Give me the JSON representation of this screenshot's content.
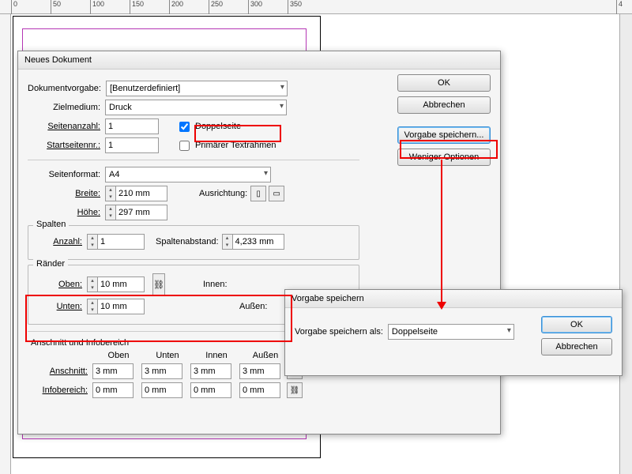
{
  "ruler_marks": [
    "0",
    "50",
    "100",
    "150",
    "200",
    "250",
    "300",
    "350",
    "4"
  ],
  "dialog": {
    "title": "Neues Dokument",
    "labels": {
      "dokvorgabe": "Dokumentvorgabe:",
      "zielmedium": "Zielmedium:",
      "seitenanzahl": "Seitenanzahl:",
      "startseite": "Startseitennr.:",
      "seitenformat": "Seitenformat:",
      "breite": "Breite:",
      "hoehe": "Höhe:",
      "ausrichtung": "Ausrichtung:",
      "spalten": "Spalten",
      "anzahl": "Anzahl:",
      "spaltenabstand": "Spaltenabstand:",
      "raender": "Ränder",
      "oben": "Oben:",
      "unten": "Unten:",
      "innen": "Innen:",
      "aussen": "Außen:",
      "anschnitt_info": "Anschnitt und Infobereich",
      "anschnitt": "Anschnitt:",
      "infobereich": "Infobereich:"
    },
    "values": {
      "dokvorgabe": "[Benutzerdefiniert]",
      "zielmedium": "Druck",
      "seitenanzahl": "1",
      "startseite": "1",
      "seitenformat": "A4",
      "breite": "210 mm",
      "hoehe": "297 mm",
      "spalten_anzahl": "1",
      "spaltenabstand": "4,233 mm",
      "rand_oben": "10 mm",
      "rand_unten": "10 mm",
      "anschnitt": "3 mm",
      "infobereich": "0 mm"
    },
    "checks": {
      "doppelseite": "Doppelseite",
      "doppelseite_checked": true,
      "textrahmen": "Primärer Textrahmen",
      "textrahmen_checked": false
    },
    "headers": {
      "oben": "Oben",
      "unten": "Unten",
      "innen": "Innen",
      "aussen": "Außen"
    },
    "buttons": {
      "ok": "OK",
      "abbrechen": "Abbrechen",
      "vorgabe_speichern": "Vorgabe speichern...",
      "weniger_opt": "Weniger Optionen"
    }
  },
  "save_dialog": {
    "title": "Vorgabe speichern",
    "label": "Vorgabe speichern als:",
    "value": "Doppelseite",
    "ok": "OK",
    "abbrechen": "Abbrechen"
  }
}
